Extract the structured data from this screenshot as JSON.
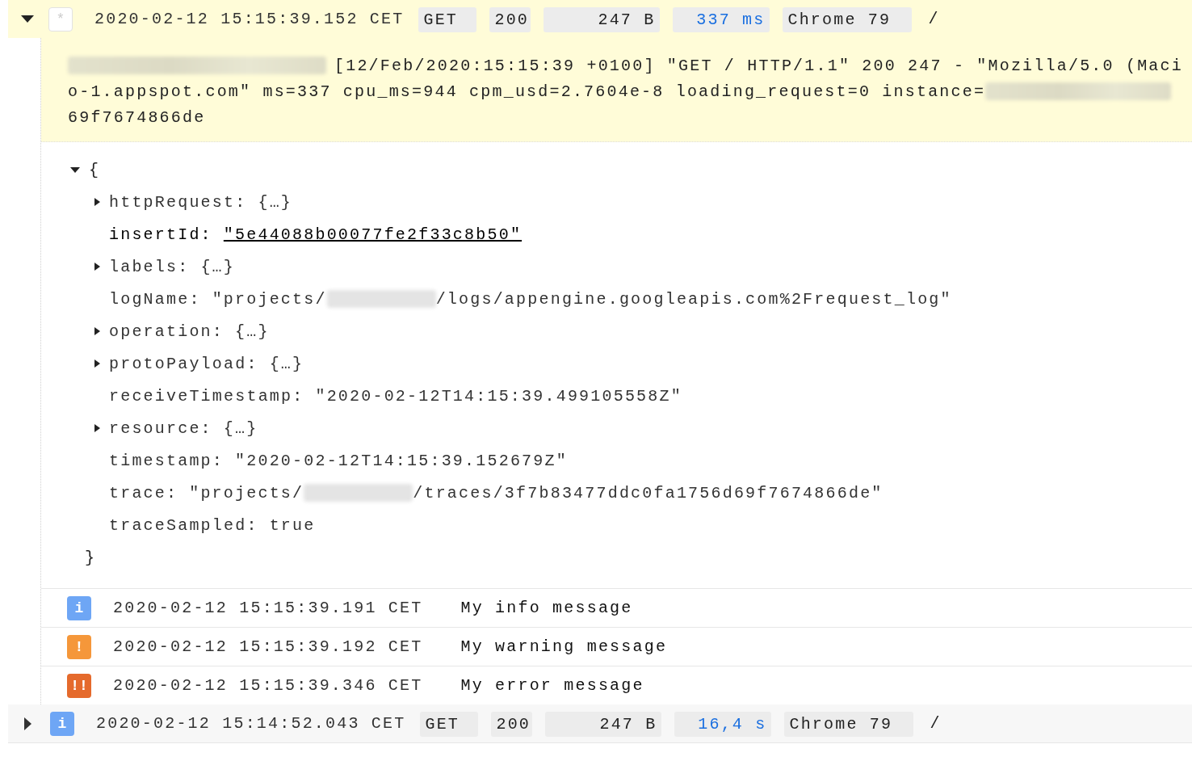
{
  "entries": [
    {
      "expanded": true,
      "severity": {
        "kind": "default",
        "glyph": "*"
      },
      "timestamp": "2020-02-12 15:15:39.152 CET",
      "method": "GET",
      "status": "200",
      "size": "247 B",
      "latency": "337 ms",
      "agent": "Chrome 79",
      "path": "/",
      "message_lines": [
        [
          {
            "kind": "redacted"
          },
          {
            "kind": "text",
            "text": "[12/Feb/2020:15:15:39 +0100] \"GET / HTTP/1.1\" 200 247 - \"Mozilla/5.0 (Maci"
          }
        ],
        [
          {
            "kind": "text",
            "text": "o-1.appspot.com\" ms=337 cpu_ms=944 cpm_usd=2.7604e-8 loading_request=0 instance="
          },
          {
            "kind": "redacted"
          }
        ],
        [
          {
            "kind": "text",
            "text": "69f7674866de"
          }
        ]
      ],
      "payload": {
        "open": "{",
        "close": "}",
        "expanded": true,
        "fields": [
          {
            "key": "httpRequest:",
            "expandable": true,
            "expanded": false,
            "link": false,
            "value": [
              {
                "kind": "text",
                "text": "{…}"
              }
            ]
          },
          {
            "key": "insertId:",
            "expandable": false,
            "link": true,
            "value": [
              {
                "kind": "text",
                "text": "\"5e44088b00077fe2f33c8b50\""
              }
            ]
          },
          {
            "key": "labels:",
            "expandable": true,
            "expanded": false,
            "link": false,
            "value": [
              {
                "kind": "text",
                "text": "{…}"
              }
            ]
          },
          {
            "key": "logName:",
            "expandable": false,
            "link": false,
            "value": [
              {
                "kind": "text",
                "text": "\"projects/"
              },
              {
                "kind": "redacted"
              },
              {
                "kind": "text",
                "text": "/logs/appengine.googleapis.com%2Frequest_log\""
              }
            ]
          },
          {
            "key": "operation:",
            "expandable": true,
            "expanded": false,
            "link": false,
            "value": [
              {
                "kind": "text",
                "text": "{…}"
              }
            ]
          },
          {
            "key": "protoPayload:",
            "expandable": true,
            "expanded": false,
            "link": false,
            "value": [
              {
                "kind": "text",
                "text": "{…}"
              }
            ]
          },
          {
            "key": "receiveTimestamp:",
            "expandable": false,
            "link": false,
            "value": [
              {
                "kind": "text",
                "text": "\"2020-02-12T14:15:39.499105558Z\""
              }
            ]
          },
          {
            "key": "resource:",
            "expandable": true,
            "expanded": false,
            "link": false,
            "value": [
              {
                "kind": "text",
                "text": "{…}"
              }
            ]
          },
          {
            "key": "timestamp:",
            "expandable": false,
            "link": false,
            "value": [
              {
                "kind": "text",
                "text": "\"2020-02-12T14:15:39.152679Z\""
              }
            ]
          },
          {
            "key": "trace:",
            "expandable": false,
            "link": false,
            "value": [
              {
                "kind": "text",
                "text": "\"projects/"
              },
              {
                "kind": "redacted"
              },
              {
                "kind": "text",
                "text": "/traces/3f7b83477ddc0fa1756d69f7674866de\""
              }
            ]
          },
          {
            "key": "traceSampled:",
            "expandable": false,
            "link": false,
            "value": [
              {
                "kind": "text",
                "text": "true"
              }
            ]
          }
        ]
      },
      "children": [
        {
          "severity": {
            "kind": "info",
            "glyph": "i"
          },
          "timestamp": "2020-02-12 15:15:39.191 CET",
          "message": "My info message"
        },
        {
          "severity": {
            "kind": "warning",
            "glyph": "!"
          },
          "timestamp": "2020-02-12 15:15:39.192 CET",
          "message": "My warning message"
        },
        {
          "severity": {
            "kind": "error",
            "glyph": "!!"
          },
          "timestamp": "2020-02-12 15:15:39.346 CET",
          "message": "My error message"
        }
      ]
    },
    {
      "expanded": false,
      "severity": {
        "kind": "info",
        "glyph": "i"
      },
      "timestamp": "2020-02-12 15:14:52.043 CET",
      "method": "GET",
      "status": "200",
      "size": "247 B",
      "latency": "16,4 s",
      "agent": "Chrome 79",
      "path": "/"
    }
  ]
}
